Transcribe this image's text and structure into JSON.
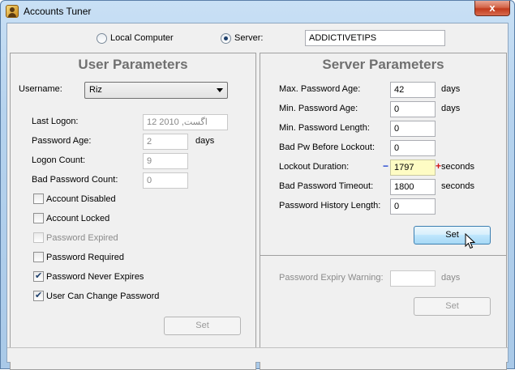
{
  "window": {
    "title": "Accounts Tuner",
    "close_glyph": "x"
  },
  "mode": {
    "local_label": "Local Computer",
    "server_label": "Server:",
    "selected": "server",
    "server_value": "ADDICTIVETIPS"
  },
  "user_params": {
    "title": "User Parameters",
    "username_label": "Username:",
    "username_value": "Riz",
    "last_logon_label": "Last Logon:",
    "last_logon_value": "12 2010 ,اگست",
    "password_age_label": "Password Age:",
    "password_age_value": "2",
    "password_age_unit": "days",
    "logon_count_label": "Logon Count:",
    "logon_count_value": "9",
    "bad_password_count_label": "Bad Password Count:",
    "bad_password_count_value": "0",
    "checkboxes": [
      {
        "label": "Account Disabled",
        "checked": false,
        "enabled": true
      },
      {
        "label": "Account Locked",
        "checked": false,
        "enabled": true
      },
      {
        "label": "Password Expired",
        "checked": false,
        "enabled": false
      },
      {
        "label": "Password Required",
        "checked": false,
        "enabled": true
      },
      {
        "label": "Password Never Expires",
        "checked": true,
        "enabled": true
      },
      {
        "label": "User Can Change Password",
        "checked": true,
        "enabled": true
      }
    ],
    "set_label": "Set"
  },
  "server_params": {
    "title": "Server Parameters",
    "max_age_label": "Max. Password Age:",
    "max_age_value": "42",
    "max_age_unit": "days",
    "min_age_label": "Min. Password Age:",
    "min_age_value": "0",
    "min_age_unit": "days",
    "min_length_label": "Min. Password Length:",
    "min_length_value": "0",
    "bad_pw_label": "Bad Pw Before Lockout:",
    "bad_pw_value": "0",
    "lockout_label": "Lockout Duration:",
    "lockout_minus": "−",
    "lockout_value": "1797",
    "lockout_plus": "+",
    "lockout_unit": "seconds",
    "timeout_label": "Bad Password Timeout:",
    "timeout_value": "1800",
    "timeout_unit": "seconds",
    "history_label": "Password History Length:",
    "history_value": "0",
    "set_label": "Set",
    "expiry_warning_label": "Password Expiry Warning:",
    "expiry_warning_value": "",
    "expiry_warning_unit": "days",
    "expiry_set_label": "Set"
  }
}
